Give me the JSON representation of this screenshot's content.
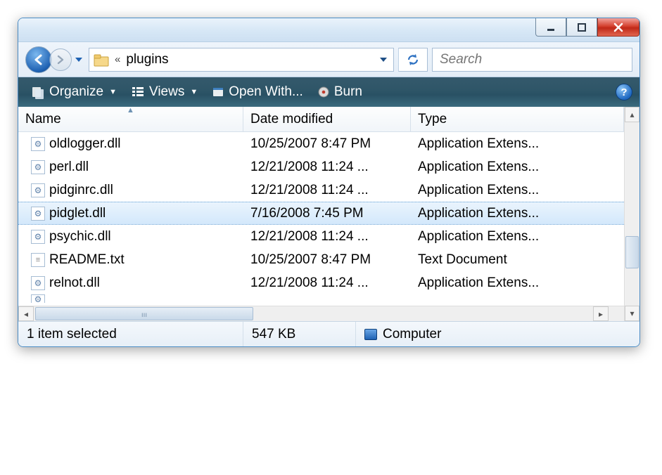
{
  "address": {
    "crumb_separator": "«",
    "current_folder": "plugins"
  },
  "search": {
    "placeholder": "Search"
  },
  "command_bar": {
    "organize": "Organize",
    "views": "Views",
    "open_with": "Open With...",
    "burn": "Burn"
  },
  "columns": {
    "name": "Name",
    "date": "Date modified",
    "type": "Type"
  },
  "files": [
    {
      "name": "oldlogger.dll",
      "date": "10/25/2007 8:47 PM",
      "type": "Application Extens...",
      "icon": "dll"
    },
    {
      "name": "perl.dll",
      "date": "12/21/2008 11:24 ...",
      "type": "Application Extens...",
      "icon": "dll"
    },
    {
      "name": "pidginrc.dll",
      "date": "12/21/2008 11:24 ...",
      "type": "Application Extens...",
      "icon": "dll"
    },
    {
      "name": "pidglet.dll",
      "date": "7/16/2008 7:45 PM",
      "type": "Application Extens...",
      "icon": "dll",
      "selected": true
    },
    {
      "name": "psychic.dll",
      "date": "12/21/2008 11:24 ...",
      "type": "Application Extens...",
      "icon": "dll"
    },
    {
      "name": "README.txt",
      "date": "10/25/2007 8:47 PM",
      "type": "Text Document",
      "icon": "txt"
    },
    {
      "name": "relnot.dll",
      "date": "12/21/2008 11:24 ...",
      "type": "Application Extens...",
      "icon": "dll"
    }
  ],
  "status": {
    "selection": "1 item selected",
    "size": "547 KB",
    "location": "Computer"
  }
}
